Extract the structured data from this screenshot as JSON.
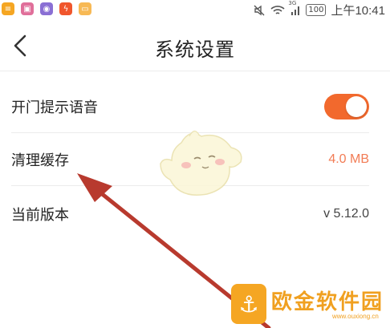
{
  "status_bar": {
    "app_icons": [
      {
        "name": "notes-app-icon",
        "color": "#f5a623"
      },
      {
        "name": "gallery-app-icon",
        "color": "#e06f9a"
      },
      {
        "name": "camera-app-icon",
        "color": "#8a6fd4"
      },
      {
        "name": "flash-app-icon",
        "color": "#f0562d"
      },
      {
        "name": "folder-app-icon",
        "color": "#f7b955"
      }
    ],
    "network_type": "3G",
    "battery": "100",
    "time": "上午10:41"
  },
  "header": {
    "title": "系统设置"
  },
  "settings": {
    "voice_prompt": {
      "label": "开门提示语音",
      "enabled": true,
      "accent_color": "#f2692d"
    },
    "clear_cache": {
      "label": "清理缓存",
      "value": "4.0 MB",
      "value_color": "#f27c55"
    },
    "version": {
      "label": "当前版本",
      "value": "v 5.12.0"
    }
  },
  "watermark": {
    "text": "欧金软件园",
    "sub": "www.ouxiong.cn"
  },
  "annotation_color": "#b83a2e"
}
